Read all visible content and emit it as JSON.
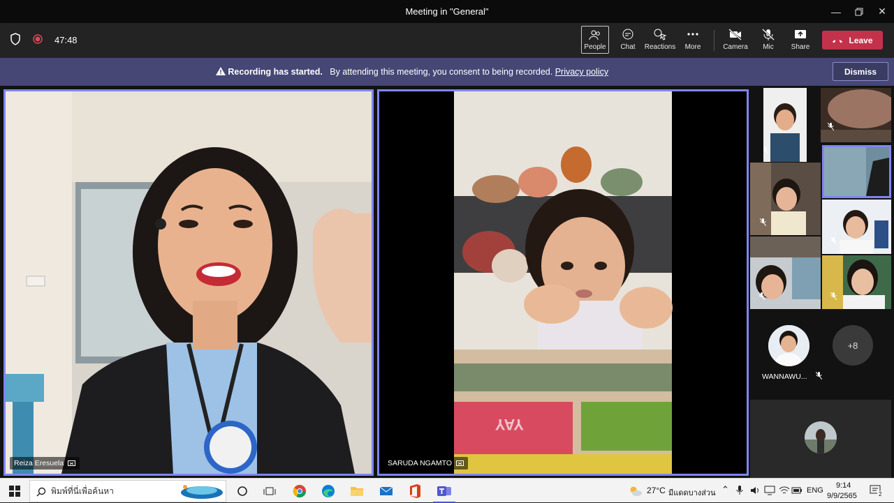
{
  "window": {
    "title": "Meeting in \"General\""
  },
  "toolbar": {
    "timer": "47:48",
    "buttons": {
      "people": "People",
      "chat": "Chat",
      "reactions": "Reactions",
      "more": "More",
      "camera": "Camera",
      "mic": "Mic",
      "share": "Share"
    },
    "leave": "Leave"
  },
  "banner": {
    "bold": "Recording has started.",
    "text": "By attending this meeting, you consent to being recorded.",
    "link": "Privacy policy",
    "dismiss": "Dismiss"
  },
  "participants": {
    "main_left": "Reiza Eresuela",
    "main_right": "SARUDA NGAMTO",
    "avatar_name": "WANNAWU...",
    "overflow": "+8"
  },
  "taskbar": {
    "search_placeholder": "พิมพ์ที่นี่เพื่อค้นหา",
    "weather_temp": "27°C",
    "weather_desc": "มีแดดบางส่วน",
    "lang": "ENG",
    "time": "9:14",
    "date": "9/9/2565",
    "notif_count": "2"
  },
  "colors": {
    "accent": "#7f85f5",
    "leave": "#c4314b",
    "banner": "#464775"
  }
}
